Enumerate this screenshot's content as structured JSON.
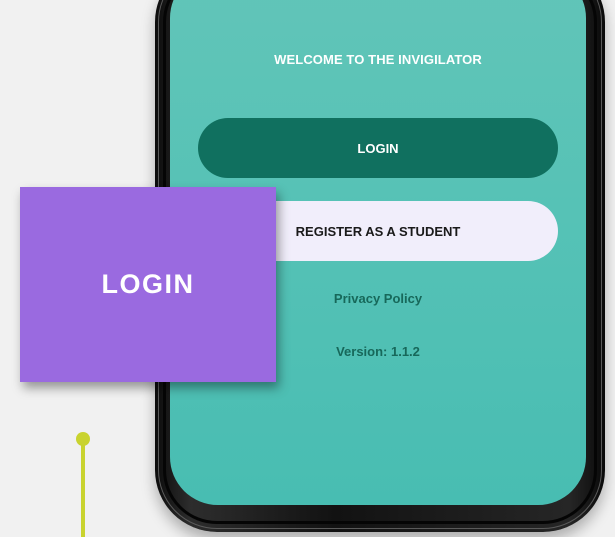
{
  "app": {
    "welcome_text": "WELCOME TO THE INVIGILATOR",
    "login_label": "LOGIN",
    "register_label": "REGISTER AS A STUDENT",
    "privacy_label": "Privacy Policy",
    "version_text": "Version: 1.1.2"
  },
  "overlay": {
    "title": "LOGIN"
  },
  "colors": {
    "screen_teal": "#56c2b6",
    "login_button": "#10705f",
    "register_button": "#f1eefb",
    "overlay_purple": "#9a6ae0",
    "accent_pin": "#c9d32f"
  }
}
